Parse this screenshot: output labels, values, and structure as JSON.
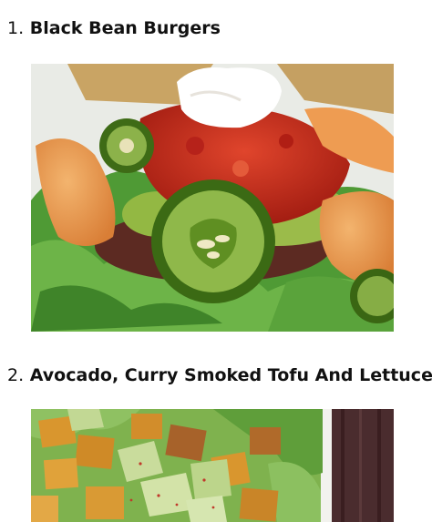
{
  "recipes": [
    {
      "number": "1.",
      "name": "Black Bean Burgers"
    },
    {
      "number": "2.",
      "name": "Avocado, Curry Smoked Tofu And Lettuce"
    }
  ],
  "colors": {
    "salsa": "#c8281c",
    "lettuce": "#4f9a35",
    "jalapeno": "#5f8f22",
    "chipotle_sauce": "#e8954a",
    "tofu": "#d9962e",
    "avocado": "#c9dc9c"
  }
}
